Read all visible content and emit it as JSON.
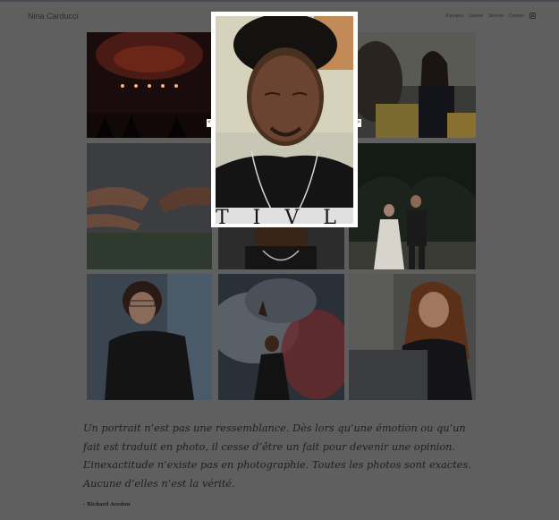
{
  "header": {
    "brand": "Nina Carducci",
    "nav": [
      "À propos",
      "Galerie",
      "Service",
      "Contact"
    ],
    "social_icon": "instagram-icon"
  },
  "gallery": {
    "items": [
      "concert",
      "person-with-hat",
      "woman-smiling-outdoors",
      "hands-reaching",
      "man-in-lightbox-area",
      "wedding-couple",
      "woman-with-glasses",
      "person-in-smoke",
      "woman-with-laptop"
    ]
  },
  "lightbox": {
    "image": "portrait-of-man-with-eyes-closed",
    "prev_label": "<",
    "next_label": ">"
  },
  "quote": {
    "text": "Un portrait n’est pas une ressemblance. Dès lors qu’une émotion ou qu’un fait est traduit en photo, il cesse d’être un fait pour devenir une opinion. L’inexactitude n’existe pas en photographie. Toutes les photos sont exactes. Aucune d’elles n’est la vérité.",
    "author": "- Richard Avedon"
  }
}
